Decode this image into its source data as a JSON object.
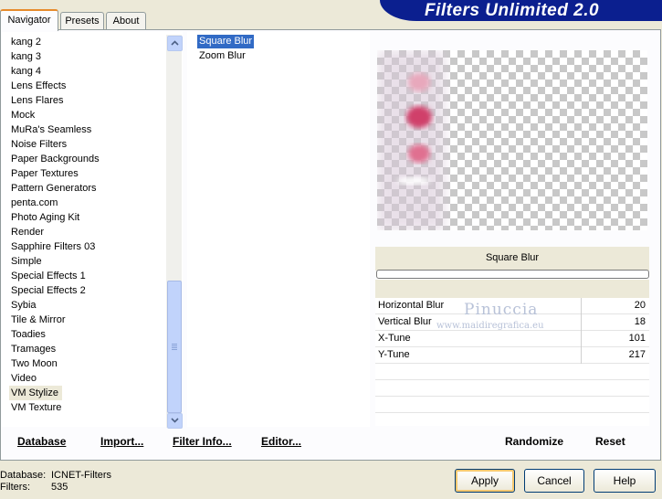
{
  "tabs": [
    "Navigator",
    "Presets",
    "About"
  ],
  "banner_title": "Filters Unlimited 2.0",
  "categories": [
    "kang 2",
    "kang 3",
    "kang 4",
    "Lens Effects",
    "Lens Flares",
    "Mock",
    "MuRa's Seamless",
    "Noise Filters",
    "Paper Backgrounds",
    "Paper Textures",
    "Pattern Generators",
    "penta.com",
    "Photo Aging Kit",
    "Render",
    "Sapphire Filters 03",
    "Simple",
    "Special Effects 1",
    "Special Effects 2",
    "Sybia",
    "Tile & Mirror",
    "Toadies",
    "Tramages",
    "Two Moon",
    "Video",
    "VM Stylize",
    "VM Texture"
  ],
  "selected_category": "VM Stylize",
  "filters": [
    "Square Blur",
    "Zoom Blur"
  ],
  "selected_filter": "Square Blur",
  "preview": {
    "filter_name": "Square Blur",
    "watermark_name": "Pinuccia",
    "watermark_url": "www.maidiregrafica.eu"
  },
  "params": [
    {
      "name": "Horizontal Blur",
      "value": "20"
    },
    {
      "name": "Vertical Blur",
      "value": "18"
    },
    {
      "name": "X-Tune",
      "value": "101"
    },
    {
      "name": "Y-Tune",
      "value": "217"
    }
  ],
  "links": {
    "database": "Database",
    "import": "Import...",
    "filter_info": "Filter Info...",
    "editor": "Editor...",
    "randomize": "Randomize",
    "reset": "Reset"
  },
  "status": {
    "database_label": "Database:",
    "database_value": "ICNET-Filters",
    "filters_label": "Filters:",
    "filters_value": "535"
  },
  "buttons": {
    "apply": "Apply",
    "cancel": "Cancel",
    "help": "Help"
  },
  "colors": {
    "banner": "#0b1f8f",
    "selection": "#316ac5",
    "tab_highlight": "#e68b2c"
  }
}
